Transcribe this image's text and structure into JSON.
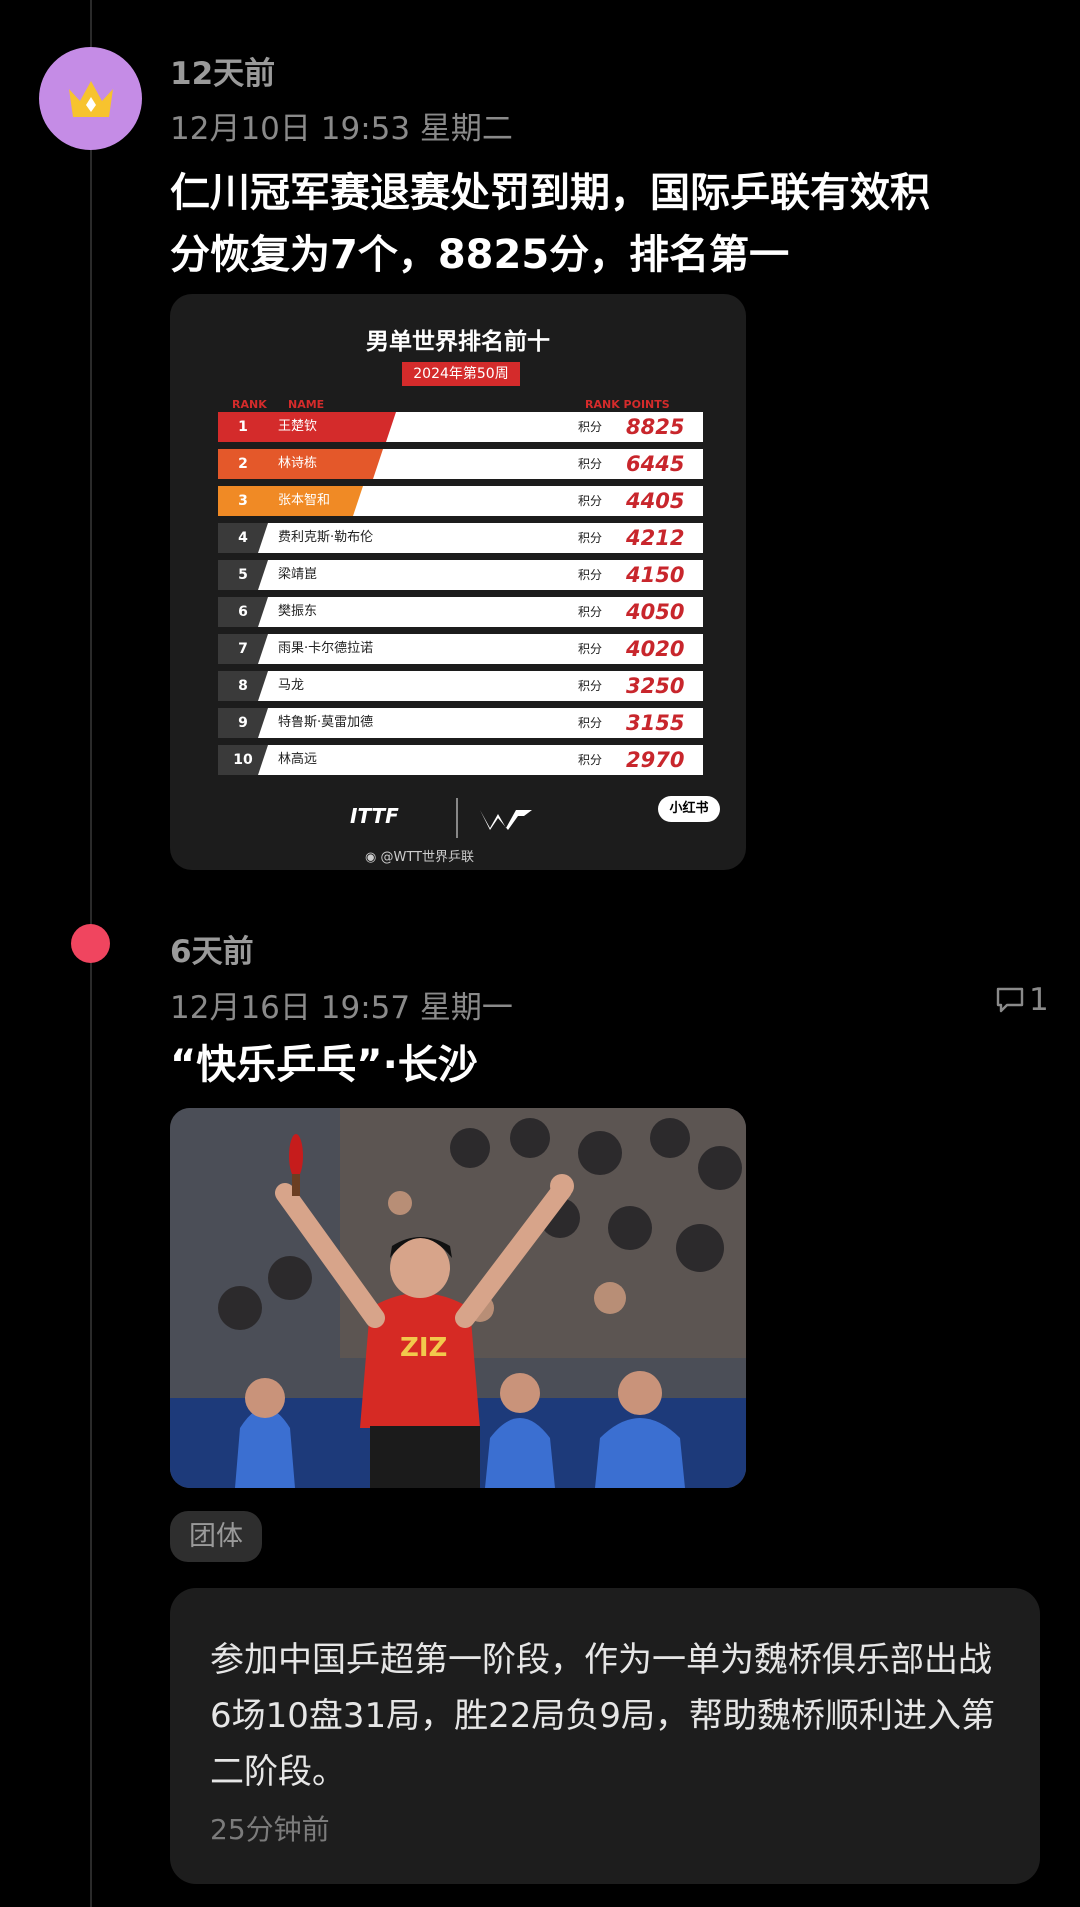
{
  "post1": {
    "ago": "12天前",
    "date": "12月10日 19:53 星期二",
    "title_line1": "仁川冠军赛退赛处罚到期，国际乒联有效积",
    "title_line2": "分恢复为7个，8825分，排名第一"
  },
  "rank_card": {
    "title": "男单世界排名前十",
    "subtitle": "2024年第50周",
    "header_rank": "RANK",
    "header_name": "NAME",
    "header_points": "RANK POINTS",
    "points_label": "积分",
    "rows": [
      {
        "rank": "1",
        "name": "王楚钦",
        "points": "8825"
      },
      {
        "rank": "2",
        "name": "林诗栋",
        "points": "6445"
      },
      {
        "rank": "3",
        "name": "张本智和",
        "points": "4405"
      },
      {
        "rank": "4",
        "name": "费利克斯·勒布伦",
        "points": "4212"
      },
      {
        "rank": "5",
        "name": "梁靖崑",
        "points": "4150"
      },
      {
        "rank": "6",
        "name": "樊振东",
        "points": "4050"
      },
      {
        "rank": "7",
        "name": "雨果·卡尔德拉诺",
        "points": "4020"
      },
      {
        "rank": "8",
        "name": "马龙",
        "points": "3250"
      },
      {
        "rank": "9",
        "name": "特鲁斯·莫雷加德",
        "points": "3155"
      },
      {
        "rank": "10",
        "name": "林高远",
        "points": "2970"
      }
    ],
    "top_colors": [
      "#d42b2b",
      "#e4582a",
      "#f08a25"
    ],
    "logo_itf": "ITTF",
    "watermark": "@WTT世界乒联",
    "xhs_badge": "小红书"
  },
  "post2": {
    "ago": "6天前",
    "date": "12月16日 19:57 星期一",
    "comment_count": "1",
    "title": "“快乐乒乓”·长沙",
    "tag": "团体"
  },
  "comment": {
    "text": "参加中国乒超第一阶段，作为一单为魏桥俱乐部出战6场10盘31局，胜22局负9局，帮助魏桥顺利进入第二阶段。",
    "time": "25分钟前"
  }
}
